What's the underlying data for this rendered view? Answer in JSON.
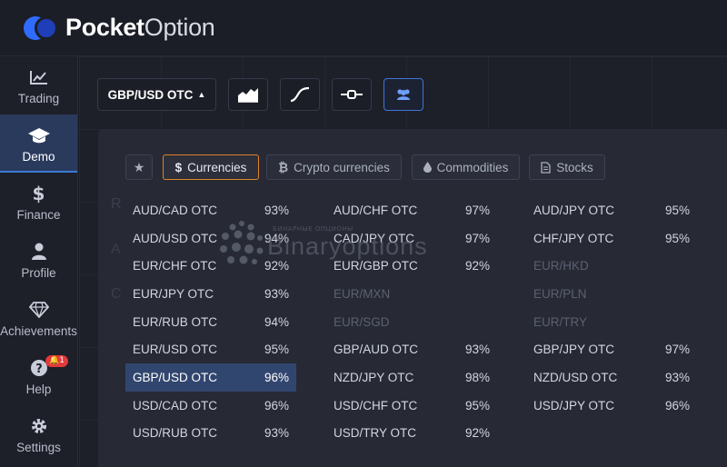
{
  "header": {
    "brand_bold": "Pocket",
    "brand_light": "Option"
  },
  "sidebar": {
    "items": [
      {
        "label": "Trading",
        "icon": "chart-up-icon"
      },
      {
        "label": "Demo",
        "icon": "graduation-cap-icon",
        "active": true
      },
      {
        "label": "Finance",
        "icon": "dollar-icon"
      },
      {
        "label": "Profile",
        "icon": "user-icon"
      },
      {
        "label": "Achievements",
        "icon": "diamond-icon"
      },
      {
        "label": "Help",
        "icon": "question-icon",
        "badge": "1"
      },
      {
        "label": "Settings",
        "icon": "gear-icon"
      }
    ]
  },
  "toolbar": {
    "pair": "GBP/USD OTC",
    "tools": [
      "area-chart-icon",
      "line-chart-icon",
      "indicator-icon",
      "traders-icon"
    ]
  },
  "tabs": [
    {
      "label": "",
      "icon": "star-icon"
    },
    {
      "label": "Currencies",
      "icon": "dollar-icon",
      "active": true
    },
    {
      "label": "Crypto currencies",
      "icon": "bitcoin-icon"
    },
    {
      "label": "Commodities",
      "icon": "drop-icon"
    },
    {
      "label": "Stocks",
      "icon": "document-icon"
    }
  ],
  "assets": {
    "col1": [
      {
        "name": "AUD/CAD OTC",
        "pct": "93%"
      },
      {
        "name": "AUD/USD OTC",
        "pct": "94%"
      },
      {
        "name": "EUR/CHF OTC",
        "pct": "92%"
      },
      {
        "name": "EUR/JPY OTC",
        "pct": "93%"
      },
      {
        "name": "EUR/RUB OTC",
        "pct": "94%"
      },
      {
        "name": "EUR/USD OTC",
        "pct": "95%"
      },
      {
        "name": "GBP/USD OTC",
        "pct": "96%",
        "selected": true
      },
      {
        "name": "USD/CAD OTC",
        "pct": "96%"
      },
      {
        "name": "USD/RUB OTC",
        "pct": "93%"
      }
    ],
    "col2": [
      {
        "name": "AUD/CHF OTC",
        "pct": "97%"
      },
      {
        "name": "CAD/JPY OTC",
        "pct": "97%"
      },
      {
        "name": "EUR/GBP OTC",
        "pct": "92%"
      },
      {
        "name": "EUR/MXN",
        "pct": "",
        "dim": true
      },
      {
        "name": "EUR/SGD",
        "pct": "",
        "dim": true
      },
      {
        "name": "GBP/AUD OTC",
        "pct": "93%"
      },
      {
        "name": "NZD/JPY OTC",
        "pct": "98%"
      },
      {
        "name": "USD/CHF OTC",
        "pct": "95%"
      },
      {
        "name": "USD/TRY OTC",
        "pct": "92%"
      }
    ],
    "col3": [
      {
        "name": "AUD/JPY OTC",
        "pct": "95%"
      },
      {
        "name": "CHF/JPY OTC",
        "pct": "95%"
      },
      {
        "name": "EUR/HKD",
        "pct": "",
        "dim": true
      },
      {
        "name": "EUR/PLN",
        "pct": "",
        "dim": true
      },
      {
        "name": "EUR/TRY",
        "pct": "",
        "dim": true
      },
      {
        "name": "GBP/JPY OTC",
        "pct": "97%"
      },
      {
        "name": "NZD/USD OTC",
        "pct": "93%"
      },
      {
        "name": "USD/JPY OTC",
        "pct": "96%"
      }
    ]
  },
  "watermark": {
    "text": "Binaryoptions",
    "subtext": "БИНАРНЫЕ ОПЦИОНЫ"
  },
  "colors": {
    "accent_blue": "#3f74d8",
    "active_tab_border": "#e0832a",
    "selected_row": "#31466e",
    "badge_red": "#e23a3a"
  }
}
